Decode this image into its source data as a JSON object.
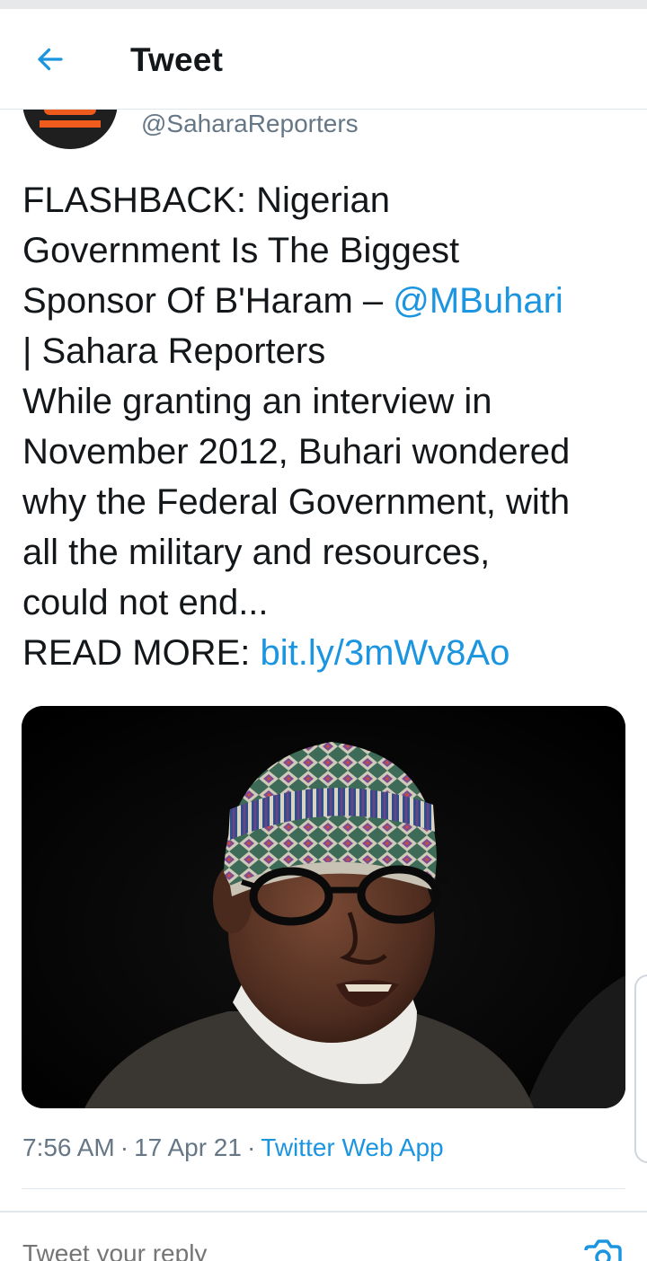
{
  "header": {
    "title": "Tweet",
    "back_icon": "arrow-left-icon",
    "accent_color": "#1b95e0"
  },
  "author": {
    "handle": "@SaharaReporters",
    "avatar_icon": "sahara-reporters-logo"
  },
  "tweet": {
    "lines": [
      {
        "text": "FLASHBACK: Nigerian"
      },
      {
        "text": "Government Is The Biggest"
      },
      {
        "text": "Sponsor Of B'Haram – ",
        "mention": "@MBuhari"
      },
      {
        "text": "| Sahara Reporters"
      },
      {
        "text": "While granting an interview in"
      },
      {
        "text": "November 2012, Buhari wondered"
      },
      {
        "text": "why the Federal Government, with"
      },
      {
        "text": "all the military and resources,"
      },
      {
        "text": "could not end..."
      },
      {
        "text": "READ MORE: ",
        "link": "bit.ly/3mWv8Ao"
      }
    ]
  },
  "media": {
    "type": "photo"
  },
  "meta": {
    "time": "7:56 AM",
    "date": "17 Apr 21",
    "source": "Twitter Web App",
    "separator": "·"
  },
  "reply": {
    "placeholder": "Tweet your reply",
    "camera_icon": "camera-icon"
  }
}
